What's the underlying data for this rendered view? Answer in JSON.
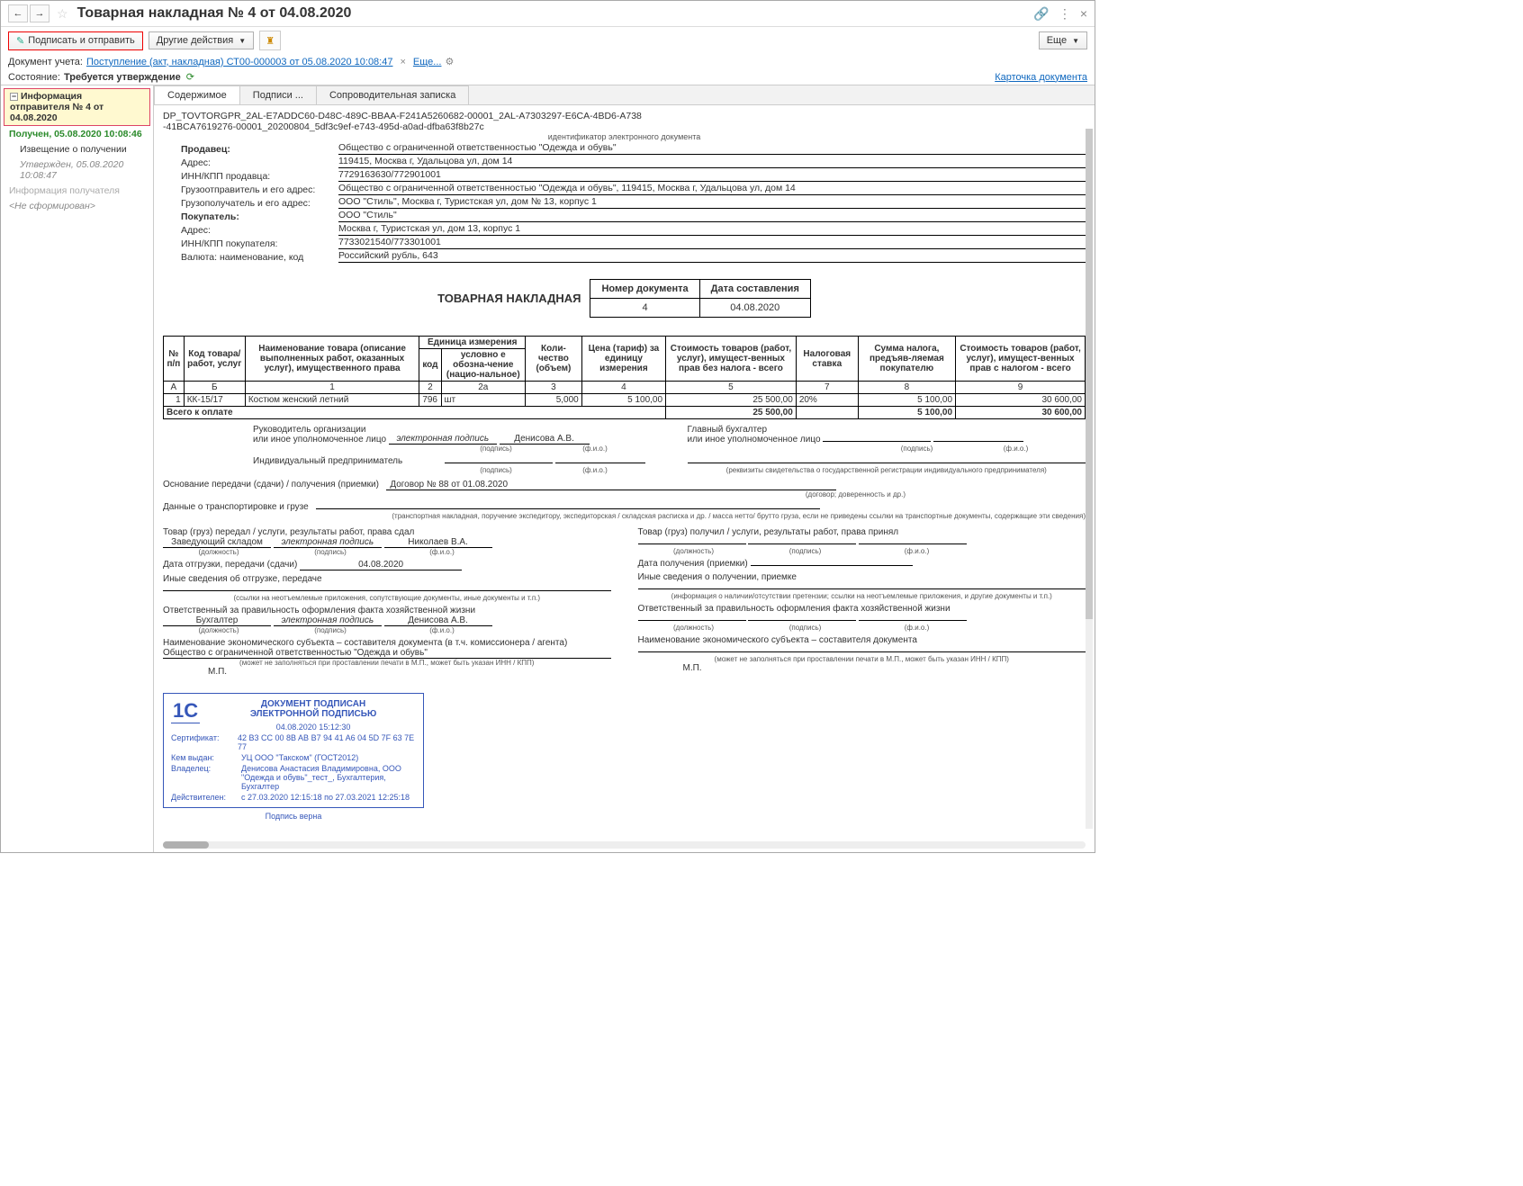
{
  "titlebar": {
    "back_glyph": "←",
    "fwd_glyph": "→",
    "star_glyph": "☆",
    "title": "Товарная накладная № 4 от 04.08.2020",
    "link_glyph": "🔗",
    "dots_glyph": "⋮",
    "close_glyph": "×"
  },
  "toolbar": {
    "sign_send": "Подписать и отправить",
    "other_actions": "Другие действия",
    "more_btn": "Еще"
  },
  "infobar": {
    "label": "Документ учета:",
    "doc_link": "Поступление (акт, накладная) СТ00-000003 от 05.08.2020 10:08:47",
    "more": "Еще...",
    "x": "×"
  },
  "status": {
    "label": "Состояние:",
    "value": "Требуется утверждение"
  },
  "doc_card_link": "Карточка документа",
  "sidebar": {
    "hdr": "Информация отправителя № 4 от 04.08.2020",
    "received": "Получен, 05.08.2020 10:08:46",
    "notice": "Извещение о получении",
    "approved": "Утвержден, 05.08.2020 10:08:47",
    "recipient_info": "Информация получателя",
    "not_formed": "<Не сформирован>"
  },
  "tabs": {
    "content": "Содержимое",
    "signatures": "Подписи ...",
    "cover_note": "Сопроводительная записка"
  },
  "doc": {
    "id1": "DP_TOVTORGPR_2AL-E7ADDC60-D48C-489C-BBAA-F241A5260682-00001_2AL-A7303297-E6CA-4BD6-A738",
    "id2": "-41BCA7619276-00001_20200804_5df3c9ef-e743-495d-a0ad-dfba63f8b27c",
    "id_caption": "идентификатор электронного документа",
    "fields": {
      "seller_l": "Продавец:",
      "seller_v": "Общество с ограниченной ответственностью \"Одежда и обувь\"",
      "addr_l": "Адрес:",
      "addr_v": "119415, Москва г, Удальцова ул, дом 14",
      "innkpp_s_l": "ИНН/КПП продавца:",
      "innkpp_s_v": "7729163630/772901001",
      "shipper_l": "Грузоотправитель и его адрес:",
      "shipper_v": "Общество с ограниченной ответственностью \"Одежда и обувь\", 119415, Москва г, Удальцова ул, дом 14",
      "consignee_l": "Грузополучатель и его адрес:",
      "consignee_v": "ООО \"Стиль\", Москва г, Туристская ул, дом № 13, корпус 1",
      "buyer_l": "Покупатель:",
      "buyer_v": "ООО \"Стиль\"",
      "buyer_addr_l": "Адрес:",
      "buyer_addr_v": "Москва г, Туристская ул, дом 13, корпус 1",
      "innkpp_b_l": "ИНН/КПП покупателя:",
      "innkpp_b_v": "7733021540/773301001",
      "currency_l": "Валюта: наименование, код",
      "currency_v": "Российский рубль, 643"
    },
    "tov_nak": "ТОВАРНАЯ НАКЛАДНАЯ",
    "mini": {
      "num_h": "Номер документа",
      "date_h": "Дата составления",
      "num": "4",
      "date": "04.08.2020"
    },
    "th": {
      "npp": "№ п/п",
      "code": "Код товара/ работ, услуг",
      "name": "Наименование товара (описание выполненных работ, оказанных услуг), имущественного права",
      "unit": "Единица измерения",
      "unit_code": "код",
      "unit_cond": "условно е обозна-чение (нацио-нальное)",
      "qty": "Коли-чество (объем)",
      "price": "Цена (тариф) за единицу измерения",
      "cost_notax": "Стоимость товаров (работ, услуг), имущест-венных прав без налога - всего",
      "taxrate": "Налоговая ставка",
      "taxsum": "Сумма налога, предъяв-ляемая покупателю",
      "cost_withtax": "Стоимость товаров (работ, услуг), имущест-венных прав с налогом - всего",
      "a": "А",
      "b": "Б",
      "c1": "1",
      "c2": "2",
      "c2a": "2а",
      "c3": "3",
      "c4": "4",
      "c5": "5",
      "c7": "7",
      "c8": "8",
      "c9": "9"
    },
    "row": {
      "n": "1",
      "code": "КК-15/17",
      "name": "Костюм женский летний",
      "ucode": "796",
      "uname": "шт",
      "qty": "5,000",
      "price": "5 100,00",
      "cost_nt": "25 500,00",
      "rate": "20%",
      "taxsum": "5 100,00",
      "cost_t": "30 600,00"
    },
    "total": {
      "label": "Всего к оплате",
      "cost_nt": "25 500,00",
      "taxsum": "5 100,00",
      "cost_t": "30 600,00"
    },
    "sig": {
      "head_org": "Руководитель организации\nили иное уполномоченное лицо",
      "chief_acc": "Главный бухгалтер\nили иное уполномоченное лицо",
      "esig": "электронная подпись",
      "podpis": "(подпись)",
      "fio": "(ф.и.о.)",
      "denisova": "Денисова А.В.",
      "ip": "Индивидуальный предприниматель",
      "rekvizity": "(реквизиты свидетельства о государственной регистрации индивидуального предпринимателя)",
      "basis_l": "Основание передачи (сдачи) / получения (приемки)",
      "basis_v": "Договор № 88 от 01.08.2020",
      "basis_cap": "(договор; доверенность и др.)",
      "transport_l": "Данные о транспортировке и грузе",
      "transport_cap": "(транспортная накладная, поручение экспедитору, экспедиторская / складская расписка и др. / масса нетто/ брутто груза, если не приведены ссылки на транспортные документы, содержащие эти сведения)",
      "left_hdr": "Товар (груз) передал / услуги, результаты работ, права сдал",
      "right_hdr": "Товар (груз) получил / услуги, результаты работ, права принял",
      "zav_sklad": "Заведующий складом",
      "nikolaev": "Николаев В.А.",
      "dolzh": "(должность)",
      "ship_date_l": "Дата отгрузки, передачи (сдачи)",
      "ship_date_v": "04.08.2020",
      "recv_date_l": "Дата получения (приемки)",
      "other_ship": "Иные сведения об отгрузке, передаче",
      "other_recv": "Иные сведения о получении, приемке",
      "links_cap_l": "(ссылки на неотъемлемые приложения, сопутствующие документы, иные документы и т.п.)",
      "links_cap_r": "(информация о наличии/отсутствии претензии; ссылки на неотъемлемые приложения, и другие документы и т.п.)",
      "resp_l": "Ответственный за правильность оформления факта хозяйственной жизни",
      "buh": "Бухгалтер",
      "econ_l": "Наименование экономического субъекта – составителя документа (в т.ч. комиссионера / агента)",
      "econ_r": "Наименование экономического субъекта – составителя документа",
      "econ_v": "Общество с ограниченной ответственностью \"Одежда и обувь\"",
      "mp_note": "(может не заполняться при проставлении печати в М.П., может быть указан ИНН / КПП)",
      "mp": "М.П."
    },
    "stamp": {
      "h1": "ДОКУМЕНТ ПОДПИСАН",
      "h2": "ЭЛЕКТРОННОЙ ПОДПИСЬЮ",
      "ts": "04.08.2020 15:12:30",
      "cert_k": "Сертификат:",
      "cert_v": "42 B3 CC 00 8B AB B7 94 41 A6 04 5D 7F 63 7E 77",
      "issuer_k": "Кем выдан:",
      "issuer_v": "УЦ ООО \"Такском\" (ГОСТ2012)",
      "owner_k": "Владелец:",
      "owner_v": "Денисова Анастасия Владимировна, ООО \"Одежда и обувь\"_тест_, Бухгалтерия, Бухгалтер",
      "valid_k": "Действителен:",
      "valid_v": "с 27.03.2020 12:15:18 по 27.03.2021 12:25:18",
      "foot": "Подпись верна",
      "logo": "1С"
    }
  }
}
